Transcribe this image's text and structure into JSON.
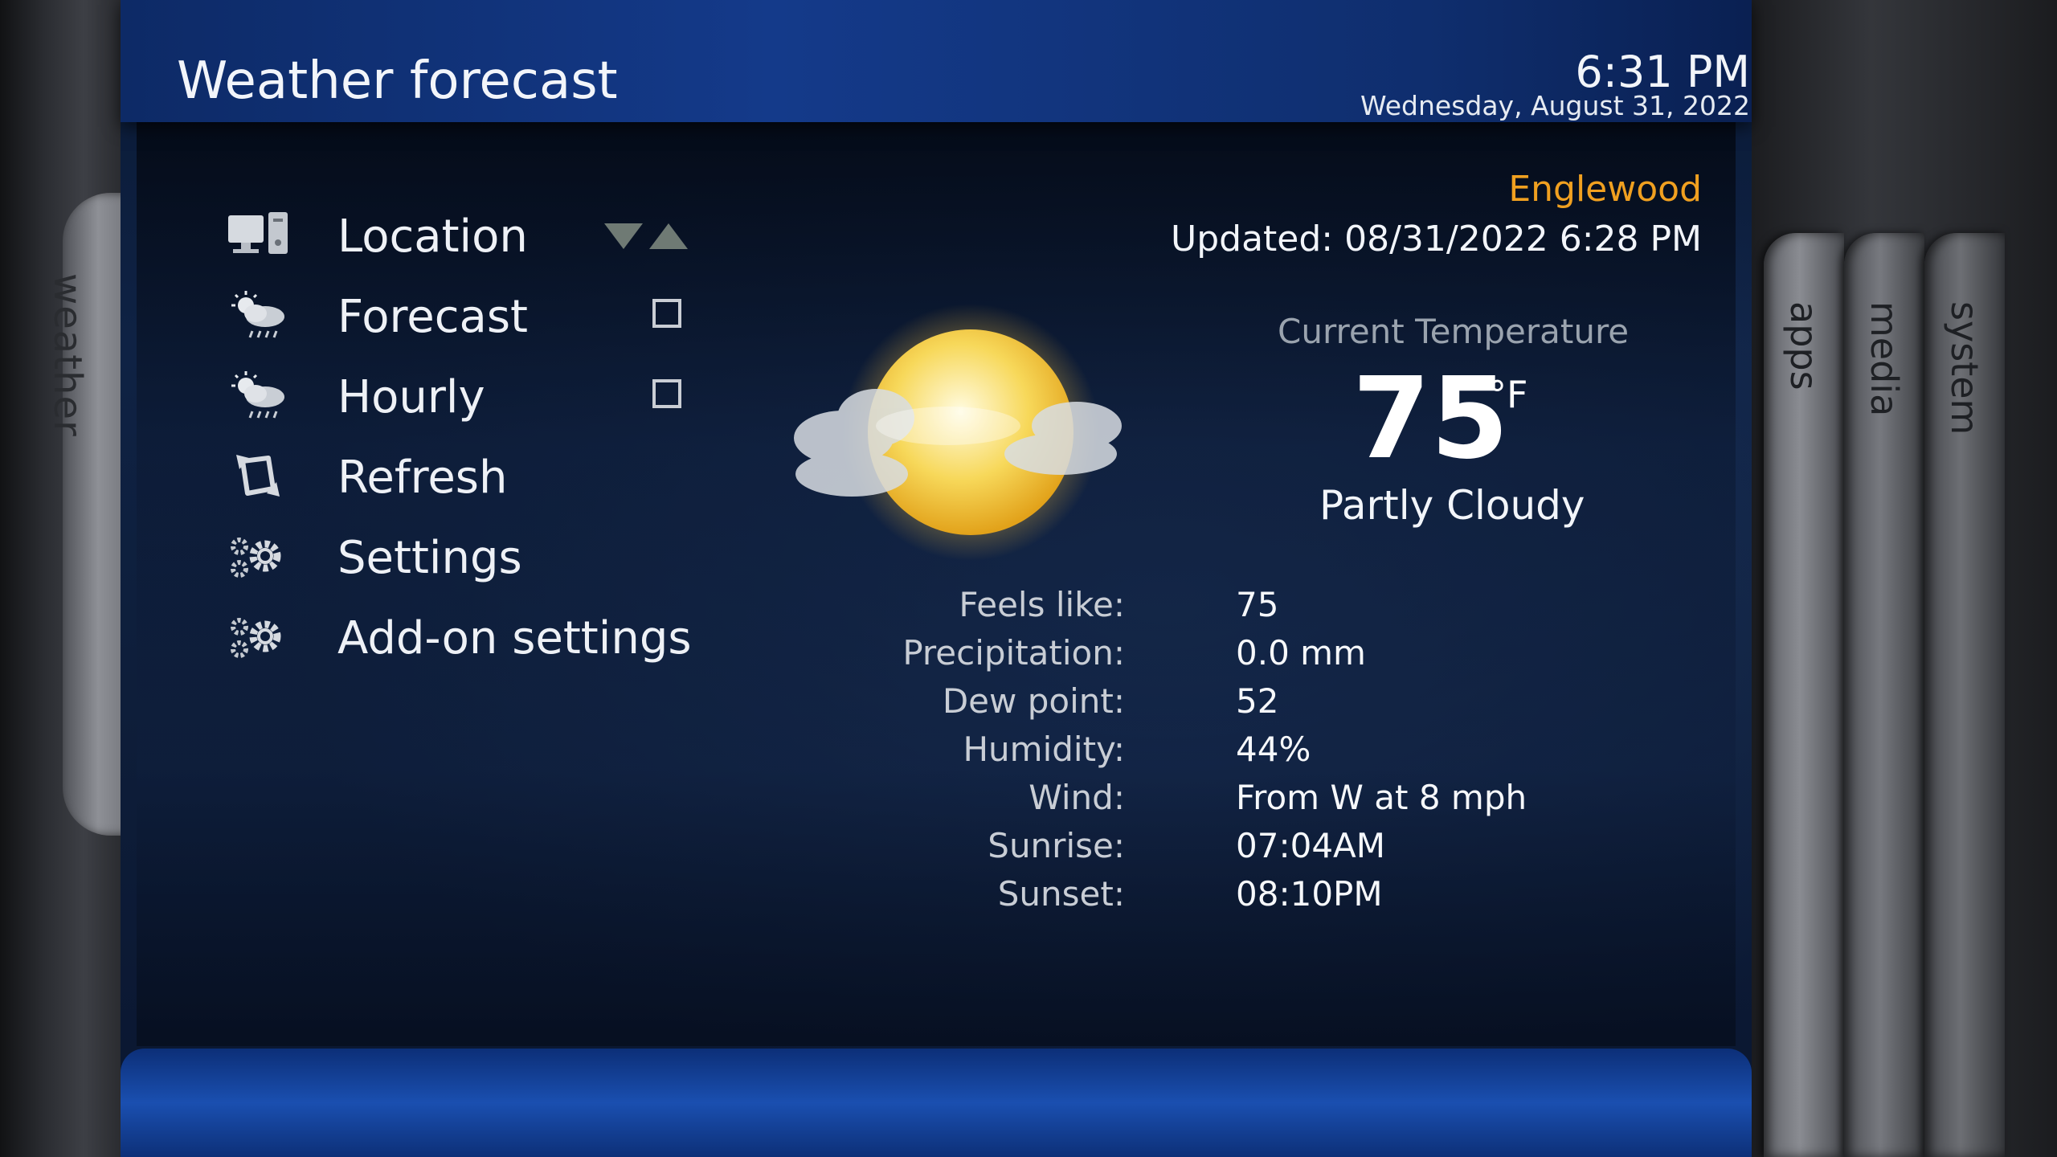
{
  "header": {
    "title": "Weather forecast",
    "time": "6:31 PM",
    "date": "Wednesday, August 31, 2022"
  },
  "left_tab": {
    "label": "weather"
  },
  "right_tabs": [
    {
      "label": "apps"
    },
    {
      "label": "media"
    },
    {
      "label": "system"
    }
  ],
  "menu": [
    {
      "label": "Location",
      "icon": "location-icon",
      "control": "arrows"
    },
    {
      "label": "Forecast",
      "icon": "forecast-icon",
      "control": "checkbox",
      "checked": false
    },
    {
      "label": "Hourly",
      "icon": "hourly-icon",
      "control": "checkbox",
      "checked": false
    },
    {
      "label": "Refresh",
      "icon": "refresh-icon"
    },
    {
      "label": "Settings",
      "icon": "settings-icon"
    },
    {
      "label": "Add-on settings",
      "icon": "addon-settings-icon"
    }
  ],
  "weather": {
    "location": "Englewood",
    "updated": "Updated: 08/31/2022 6:28 PM",
    "current_label": "Current Temperature",
    "temperature": "75",
    "unit": "°F",
    "condition": "Partly Cloudy",
    "condition_icon": "partly-cloudy-icon",
    "details": [
      {
        "key": "Feels like:",
        "value": "75"
      },
      {
        "key": "Precipitation:",
        "value": "0.0 mm"
      },
      {
        "key": "Dew point:",
        "value": "52"
      },
      {
        "key": "Humidity:",
        "value": "44%"
      },
      {
        "key": "Wind:",
        "value": "From W at 8 mph"
      },
      {
        "key": "Sunrise:",
        "value": "07:04AM"
      },
      {
        "key": "Sunset:",
        "value": "08:10PM"
      }
    ]
  },
  "colors": {
    "accent": "#f0a020",
    "top_bar": "#143a8a",
    "bottom_bar": "#1a4fb0"
  }
}
